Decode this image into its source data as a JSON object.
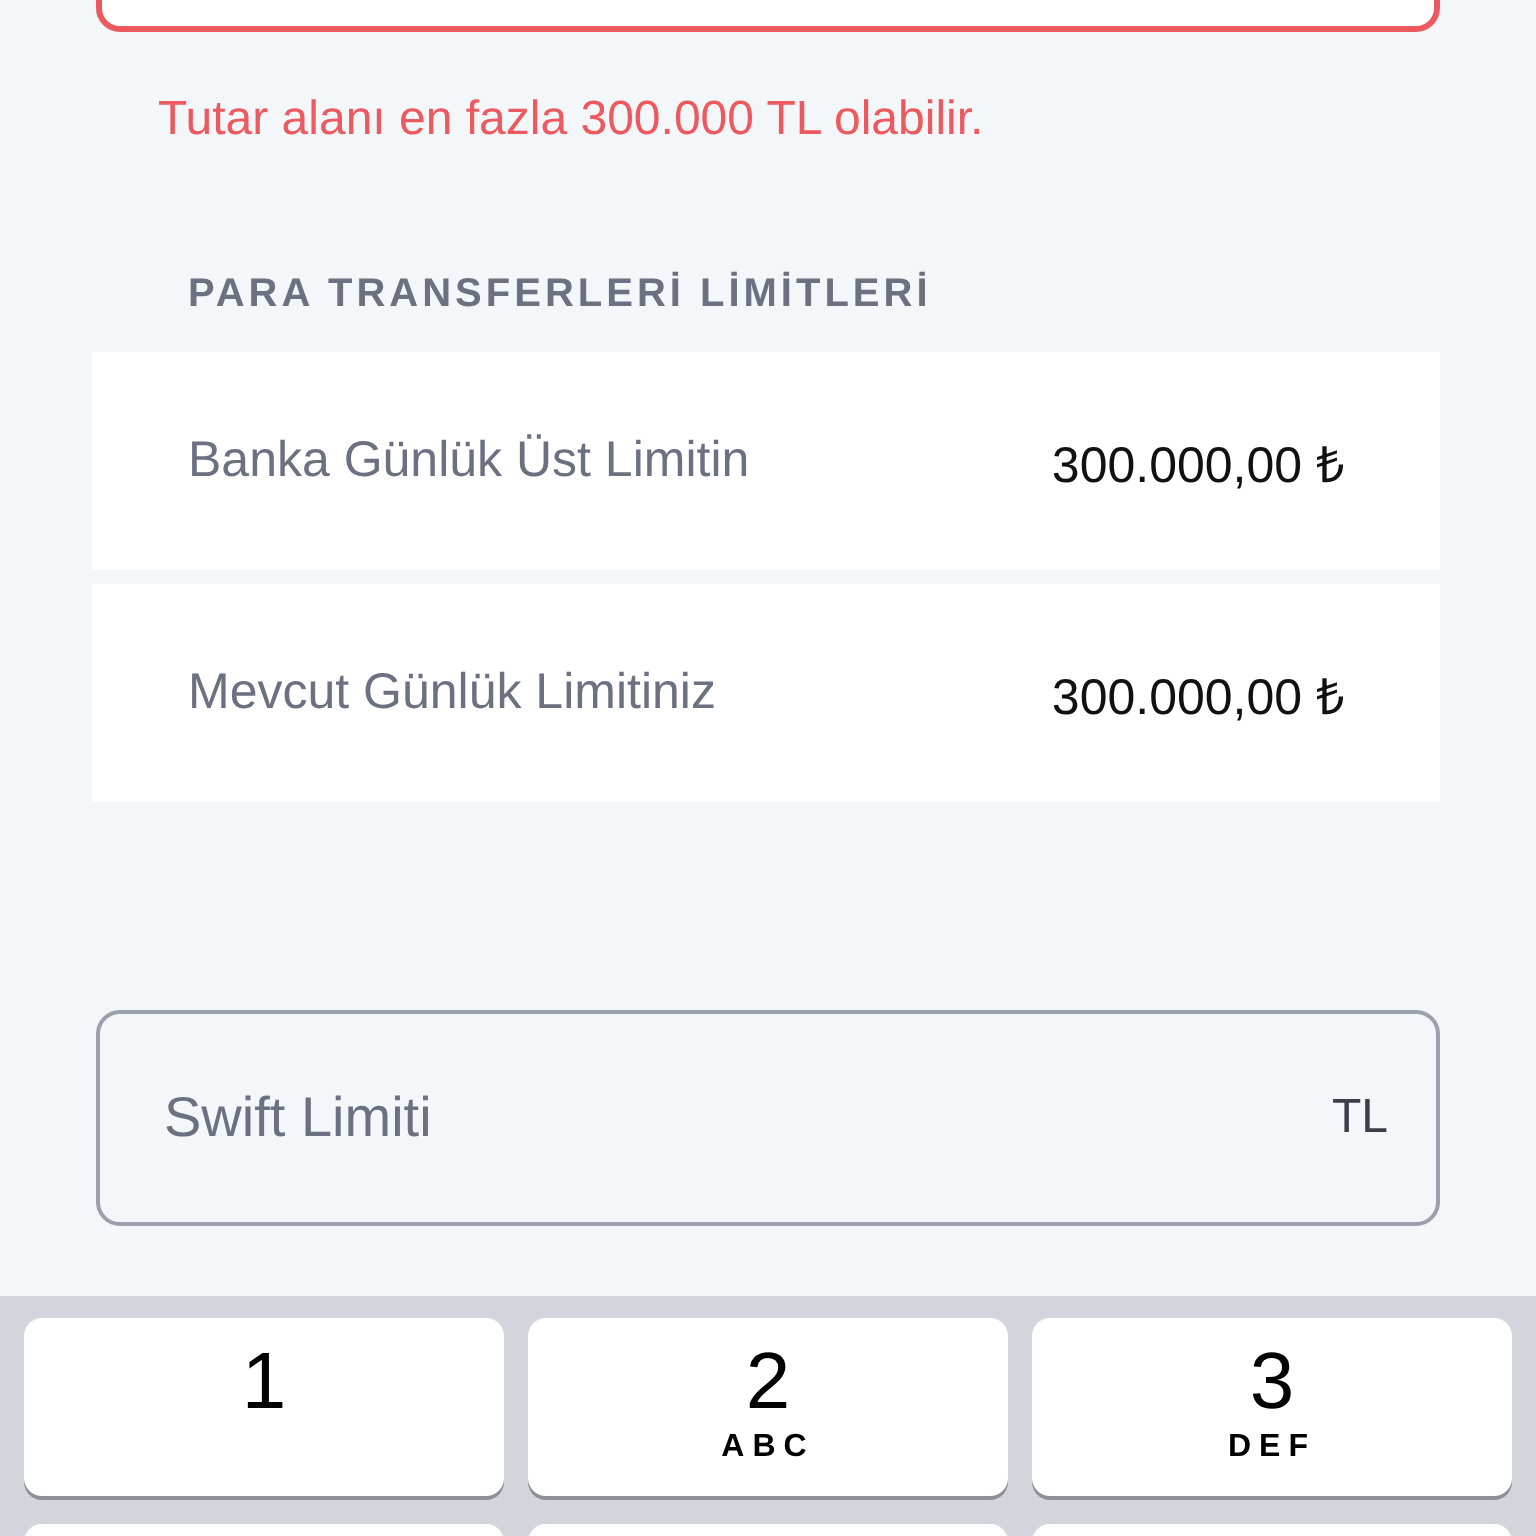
{
  "amount_field": {
    "error": true
  },
  "error_message": "Tutar alanı en fazla 300.000 TL olabilir.",
  "limits_section": {
    "title": "PARA TRANSFERLERİ LİMİTLERİ",
    "rows": [
      {
        "label": "Banka Günlük Üst Limitin",
        "value": "300.000,00 ₺"
      },
      {
        "label": "Mevcut Günlük Limitiniz",
        "value": "300.000,00 ₺"
      }
    ]
  },
  "swift_field": {
    "placeholder": "Swift Limiti",
    "suffix": "TL"
  },
  "keypad": {
    "keys": [
      {
        "digit": "1"
      },
      {
        "digit": "2",
        "letters": "ABC"
      },
      {
        "digit": "3",
        "letters": "DEF"
      }
    ]
  }
}
